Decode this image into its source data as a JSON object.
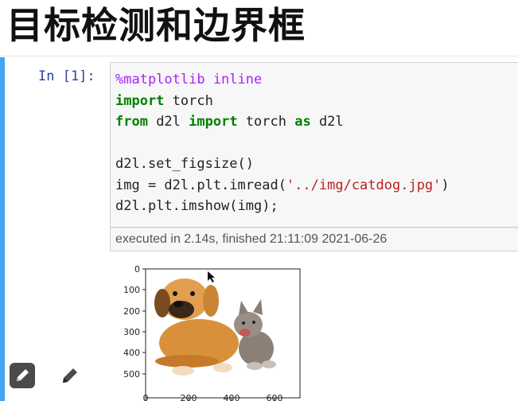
{
  "page": {
    "title": "目标检测和边界框"
  },
  "cell": {
    "prompt": "In [1]:",
    "code": {
      "line1_magic": "%matplotlib inline",
      "line2_kw": "import",
      "line2_rest": " torch",
      "line3_kw1": "from",
      "line3_mid": " d2l ",
      "line3_kw2": "import",
      "line3_mid2": " torch ",
      "line3_kw3": "as",
      "line3_end": " d2l",
      "line5": "d2l.set_figsize()",
      "line6_pre": "img = d2l.plt.imread(",
      "line6_str": "'../img/catdog.jpg'",
      "line6_post": ")",
      "line7": "d2l.plt.imshow(img);"
    },
    "exec_info": "executed in 2.14s, finished 21:11:09 2021-06-26"
  },
  "output": {
    "y_ticks": [
      "0",
      "100",
      "200",
      "300",
      "400",
      "500"
    ],
    "x_ticks": [
      "0",
      "200",
      "400",
      "600"
    ],
    "image_content": "puppy-and-kitten-photo"
  },
  "toolbar": {
    "edit_icon": "pencil-icon",
    "edit2_icon": "pencil-icon"
  },
  "colors": {
    "cell_bar": "#42a5f5",
    "prompt": "#303f9f",
    "keyword": "#008000",
    "string": "#ba2121",
    "magic": "#aa22ff"
  }
}
